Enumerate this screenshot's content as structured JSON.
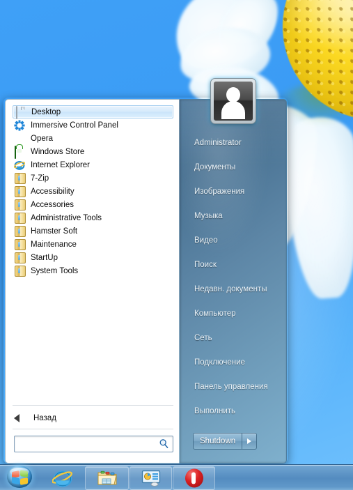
{
  "desktop": {
    "wallpaper_name": "daisy-flower-wallpaper"
  },
  "start_menu": {
    "programs": [
      {
        "label": "Desktop",
        "icon": "document-icon",
        "selected": true
      },
      {
        "label": "Immersive Control Panel",
        "icon": "gear-icon",
        "selected": false
      },
      {
        "label": "Opera",
        "icon": "opera-icon",
        "selected": false
      },
      {
        "label": "Windows Store",
        "icon": "windows-store-icon",
        "selected": false
      },
      {
        "label": "Internet Explorer",
        "icon": "internet-explorer-icon",
        "selected": false
      },
      {
        "label": "7-Zip",
        "icon": "folder-icon",
        "selected": false
      },
      {
        "label": "Accessibility",
        "icon": "folder-icon",
        "selected": false
      },
      {
        "label": "Accessories",
        "icon": "folder-icon",
        "selected": false
      },
      {
        "label": "Administrative Tools",
        "icon": "folder-icon",
        "selected": false
      },
      {
        "label": "Hamster Soft",
        "icon": "folder-icon",
        "selected": false
      },
      {
        "label": "Maintenance",
        "icon": "folder-icon",
        "selected": false
      },
      {
        "label": "StartUp",
        "icon": "folder-icon",
        "selected": false
      },
      {
        "label": "System Tools",
        "icon": "folder-icon",
        "selected": false
      }
    ],
    "back": {
      "label": "Назад",
      "icon": "back-arrow-icon"
    },
    "search": {
      "value": "",
      "placeholder": "",
      "icon": "search-icon"
    },
    "user": {
      "name": "Administrator",
      "avatar": "user-avatar"
    },
    "right_items": [
      {
        "label": "Administrator"
      },
      {
        "label": "Документы"
      },
      {
        "label": "Изображения"
      },
      {
        "label": "Музыка"
      },
      {
        "label": "Видео"
      },
      {
        "label": "Поиск"
      },
      {
        "label": "Недавн. документы"
      },
      {
        "label": "Компьютер"
      },
      {
        "label": "Сеть"
      },
      {
        "label": "Подключение"
      },
      {
        "label": "Панель управления"
      },
      {
        "label": "Выполнить"
      }
    ],
    "shutdown": {
      "label": "Shutdown",
      "arrow_icon": "chevron-right-icon"
    }
  },
  "taskbar": {
    "start_orb": {
      "name": "Start",
      "icon": "windows-orb-icon"
    },
    "buttons": [
      {
        "name": "Internet Explorer",
        "icon": "internet-explorer-icon"
      },
      {
        "name": "Windows Explorer",
        "icon": "folder-explorer-icon"
      },
      {
        "name": "Control Panel",
        "icon": "control-panel-icon"
      },
      {
        "name": "Opera",
        "icon": "opera-icon"
      }
    ]
  },
  "colors": {
    "accent_blue": "#3a9cf5",
    "taskbar_blue": "#548cc0",
    "panel_right_top": "#3f6d93",
    "panel_right_bottom": "#7fb0cd",
    "selection_blue": "#cbe4fa",
    "folder_yellow": "#f7e3a4"
  }
}
